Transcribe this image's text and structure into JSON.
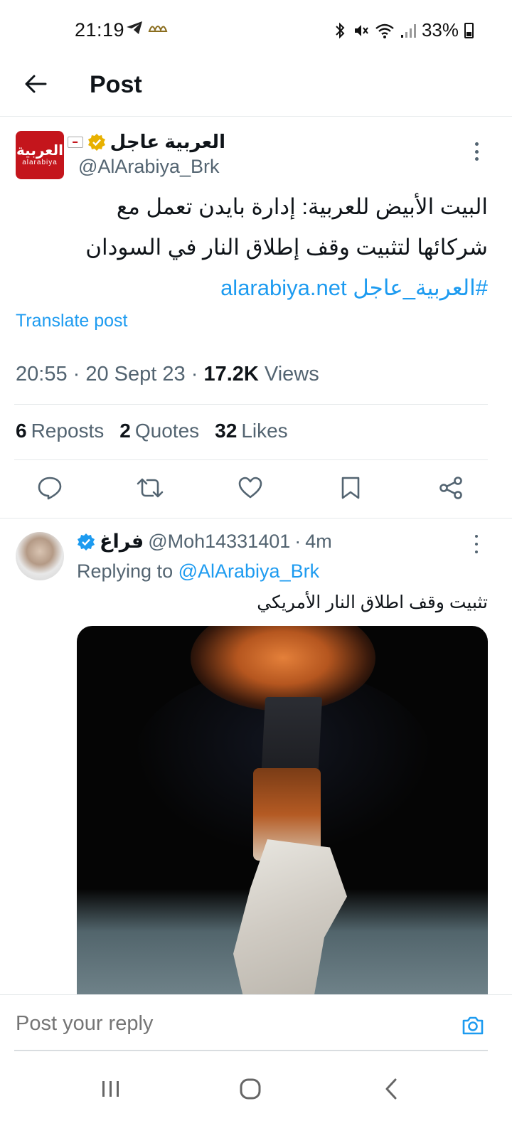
{
  "status_bar": {
    "time": "21:19",
    "battery": "33%",
    "icons": [
      "telegram-icon",
      "app-icon",
      "bluetooth-icon",
      "mute-icon",
      "wifi-icon",
      "signal-icon",
      "battery-icon"
    ]
  },
  "header": {
    "title": "Post"
  },
  "post": {
    "author_name": "العربية عاجل",
    "author_handle": "@AlArabiya_Brk",
    "avatar_text_ar": "العربية",
    "avatar_text_en": "alarabiya",
    "text_line1": "البيت الأبيض للعربية: إدارة بايدن تعمل مع",
    "text_line2": "شركائها لتثبيت وقف إطلاق النار في السودان",
    "hashtag": "#العربية_عاجل",
    "link": "alarabiya.net",
    "translate_label": "Translate post",
    "time": "20:55",
    "date": "20 Sept 23",
    "views_count": "17.2K",
    "views_label": "Views",
    "reposts_count": "6",
    "reposts_label": "Reposts",
    "quotes_count": "2",
    "quotes_label": "Quotes",
    "likes_count": "32",
    "likes_label": "Likes"
  },
  "reply": {
    "name": "فراغ",
    "handle": "@Moh14331401",
    "age": "4m",
    "replying_label": "Replying to",
    "replying_to": "@AlArabiya_Brk",
    "text": "تثبيت وقف اطلاق النار الأمريكي"
  },
  "reply_bar": {
    "placeholder": "Post your reply"
  },
  "colors": {
    "accent": "#1d9bf0",
    "text": "#0f1419",
    "muted": "#536471",
    "brand_red": "#c4151c",
    "verified_gold": "#e8b100"
  }
}
